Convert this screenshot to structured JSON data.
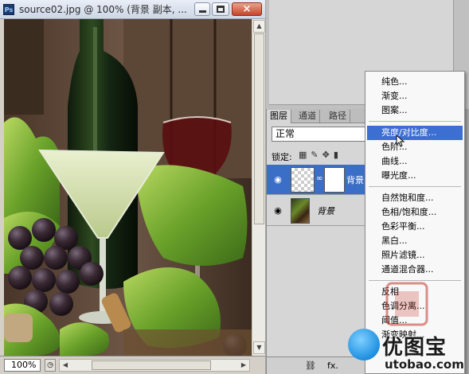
{
  "document": {
    "title": "source02.jpg @ 100% (背景 副本, ...",
    "app_icon": "Ps",
    "window_controls": {
      "minimize": "minimize-icon",
      "maximize": "maximize-icon",
      "close": "×"
    },
    "zoom": "100%"
  },
  "layers_panel": {
    "tabs": [
      "图层",
      "通道",
      "路径"
    ],
    "blend_mode": "正常",
    "lock_label": "锁定:",
    "layers": [
      {
        "name": "背景",
        "selected": true,
        "has_mask": true
      },
      {
        "name": "背景",
        "selected": false,
        "has_mask": false
      }
    ],
    "footer_icons": [
      "link-icon",
      "fx-icon"
    ],
    "fx_label": "fx."
  },
  "adjustment_menu": {
    "groups": [
      [
        "纯色...",
        "渐变...",
        "图案..."
      ],
      [
        "亮度/对比度...",
        "色阶...",
        "曲线...",
        "曝光度..."
      ],
      [
        "自然饱和度...",
        "色相/饱和度...",
        "色彩平衡...",
        "黑白...",
        "照片滤镜...",
        "通道混合器..."
      ],
      [
        "反相",
        "色调分离...",
        "阈值...",
        "渐变映射..."
      ]
    ],
    "highlighted": "亮度/对比度..."
  },
  "watermark": {
    "site_name": "优图宝",
    "url": "utobao.com"
  },
  "colors": {
    "menu_highlight": "#3d6ed2",
    "selected_layer": "#3b6fc7",
    "close_button": "#c7432a"
  }
}
